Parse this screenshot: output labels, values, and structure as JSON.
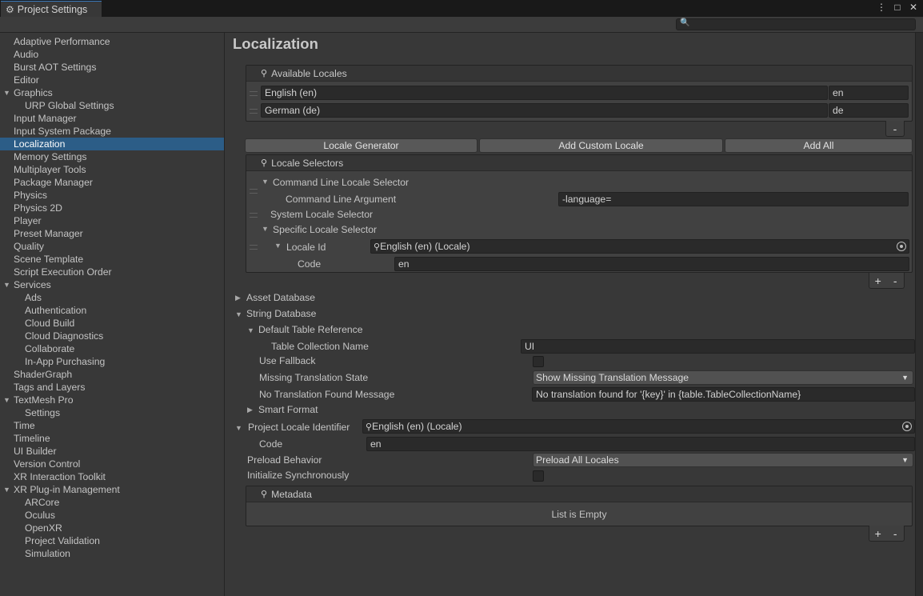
{
  "window": {
    "tab_title": "Project Settings",
    "gear_glyph": "⚙",
    "menu_glyph": "⋮",
    "maximize_glyph": "□",
    "close_glyph": "✕",
    "search_placeholder": "",
    "search_glyph": "🔍"
  },
  "sidebar": {
    "items": [
      {
        "label": "Adaptive Performance"
      },
      {
        "label": "Audio"
      },
      {
        "label": "Burst AOT Settings"
      },
      {
        "label": "Editor"
      },
      {
        "label": "Graphics"
      },
      {
        "label": "URP Global Settings"
      },
      {
        "label": "Input Manager"
      },
      {
        "label": "Input System Package"
      },
      {
        "label": "Localization"
      },
      {
        "label": "Memory Settings"
      },
      {
        "label": "Multiplayer Tools"
      },
      {
        "label": "Package Manager"
      },
      {
        "label": "Physics"
      },
      {
        "label": "Physics 2D"
      },
      {
        "label": "Player"
      },
      {
        "label": "Preset Manager"
      },
      {
        "label": "Quality"
      },
      {
        "label": "Scene Template"
      },
      {
        "label": "Script Execution Order"
      },
      {
        "label": "Services"
      },
      {
        "label": "Ads"
      },
      {
        "label": "Authentication"
      },
      {
        "label": "Cloud Build"
      },
      {
        "label": "Cloud Diagnostics"
      },
      {
        "label": "Collaborate"
      },
      {
        "label": "In-App Purchasing"
      },
      {
        "label": "ShaderGraph"
      },
      {
        "label": "Tags and Layers"
      },
      {
        "label": "TextMesh Pro"
      },
      {
        "label": "Settings"
      },
      {
        "label": "Time"
      },
      {
        "label": "Timeline"
      },
      {
        "label": "UI Builder"
      },
      {
        "label": "Version Control"
      },
      {
        "label": "XR Interaction Toolkit"
      },
      {
        "label": "XR Plug-in Management"
      },
      {
        "label": "ARCore"
      },
      {
        "label": "Oculus"
      },
      {
        "label": "OpenXR"
      },
      {
        "label": "Project Validation"
      },
      {
        "label": "Simulation"
      }
    ],
    "expand_glyph": "▼"
  },
  "main": {
    "title": "Localization",
    "available_locales": {
      "header": "Available Locales",
      "rows": [
        {
          "name": "English (en)",
          "code": "en"
        },
        {
          "name": "German (de)",
          "code": "de"
        }
      ],
      "remove": "-"
    },
    "buttons": {
      "locale_generator": "Locale Generator",
      "add_custom_locale": "Add Custom Locale",
      "add_all": "Add All"
    },
    "locale_selectors": {
      "header": "Locale Selectors",
      "command_line_selector": "Command Line Locale Selector",
      "command_line_argument_label": "Command Line Argument",
      "command_line_argument_value": "-language=",
      "system_selector": "System Locale Selector",
      "specific_selector": "Specific Locale Selector",
      "locale_id_label": "Locale Id",
      "locale_id_value": "English (en) (Locale)",
      "code_label": "Code",
      "code_value": "en",
      "add": "+",
      "remove": "-"
    },
    "asset_database": "Asset Database",
    "string_database": {
      "label": "String Database",
      "default_table_reference": "Default Table Reference",
      "table_collection_name_label": "Table Collection Name",
      "table_collection_name_value": "UI",
      "use_fallback_label": "Use Fallback",
      "missing_translation_state_label": "Missing Translation State",
      "missing_translation_state_value": "Show Missing Translation Message",
      "no_translation_found_label": "No Translation Found Message",
      "no_translation_found_value": "No translation found for '{key}' in {table.TableCollectionName}",
      "smart_format": "Smart Format"
    },
    "project_locale_identifier": {
      "label": "Project Locale Identifier",
      "value": "English (en) (Locale)",
      "code_label": "Code",
      "code_value": "en"
    },
    "preload_behavior": {
      "label": "Preload Behavior",
      "value": "Preload All Locales"
    },
    "initialize_synchronously": "Initialize Synchronously",
    "metadata": {
      "header": "Metadata",
      "empty": "List is Empty",
      "add": "+",
      "remove": "-"
    },
    "expand_glyph": "▼",
    "collapse_glyph": "▶",
    "pin_glyph": "⚲",
    "caret_glyph": "▼"
  }
}
